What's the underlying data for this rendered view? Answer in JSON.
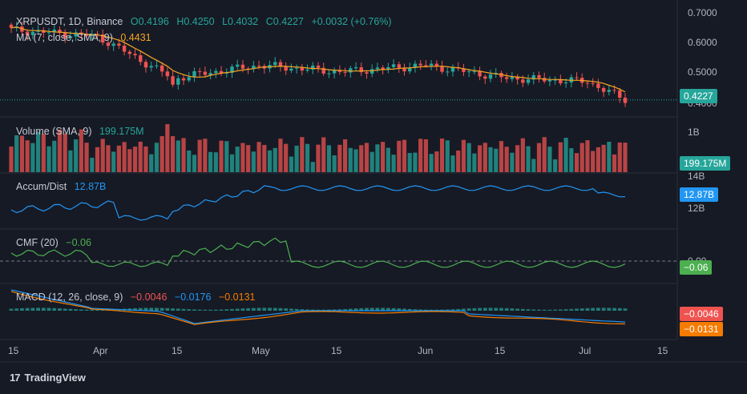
{
  "main_pane": {
    "symbol": "XRPUSDT, 1D, Binance",
    "open": "O0.4196",
    "high": "H0.4250",
    "low": "L0.4032",
    "close": "C0.4227",
    "change": "+0.0032 (+0.76%)",
    "ma_legend": "MA (7, close, SMA, 9)",
    "ma_value": "0.4431",
    "price_badge": "0.4227",
    "price_hidden_label": "0.4000",
    "yticks": [
      "0.7000",
      "0.6000",
      "0.5000"
    ]
  },
  "volume_pane": {
    "title": "Volume (SMA, 9)",
    "value": "199.175M",
    "badge": "199.175M",
    "yticks": [
      "1B"
    ]
  },
  "ad_pane": {
    "title": "Accum/Dist",
    "value": "12.87B",
    "badge": "12.87B",
    "yticks": [
      "14B",
      "12B"
    ]
  },
  "cmf_pane": {
    "title": "CMF (20)",
    "value": "−0.06",
    "badge": "−0.06",
    "yticks": [
      "0.00"
    ]
  },
  "macd_pane": {
    "title": "MACD (12, 26, close, 9)",
    "hist": "−0.0046",
    "macd": "−0.0176",
    "signal": "−0.0131",
    "badge_hist": "−0.0046",
    "badge_signal": "−0.0131"
  },
  "xaxis": [
    "15",
    "Apr",
    "15",
    "May",
    "15",
    "Jun",
    "15",
    "Jul",
    "15"
  ],
  "brand": "TradingView",
  "colors": {
    "up": "#26a69a",
    "down": "#ef5350",
    "ma": "#f5a623",
    "ad": "#2196f3",
    "cmf": "#4caf50",
    "macd": "#2196f3",
    "signal": "#f57c00",
    "bg": "#161a25",
    "grid": "#2a2e39"
  },
  "chart_data": [
    {
      "type": "candlestick",
      "title": "XRPUSDT, 1D, Binance",
      "ylim": [
        0.38,
        0.72
      ],
      "x": [
        "Mar 15",
        "Apr 1",
        "Apr 15",
        "May 1",
        "May 15",
        "Jun 1",
        "Jun 15",
        "Jul 1",
        "Jul 8"
      ],
      "close": [
        0.64,
        0.62,
        0.49,
        0.53,
        0.51,
        0.53,
        0.49,
        0.48,
        0.4227
      ],
      "ma": [
        0.63,
        0.6,
        0.52,
        0.52,
        0.51,
        0.52,
        0.5,
        0.48,
        0.4431
      ]
    },
    {
      "type": "bar",
      "title": "Volume (SMA, 9)",
      "last": "199.175M"
    },
    {
      "type": "line",
      "title": "Accum/Dist",
      "last": "12.87B"
    },
    {
      "type": "line",
      "title": "CMF (20)",
      "last": -0.06,
      "zero_line": 0
    },
    {
      "type": "line",
      "title": "MACD (12, 26, close, 9)",
      "series": [
        {
          "name": "histogram",
          "last": -0.0046
        },
        {
          "name": "macd",
          "last": -0.0176
        },
        {
          "name": "signal",
          "last": -0.0131
        }
      ]
    }
  ]
}
